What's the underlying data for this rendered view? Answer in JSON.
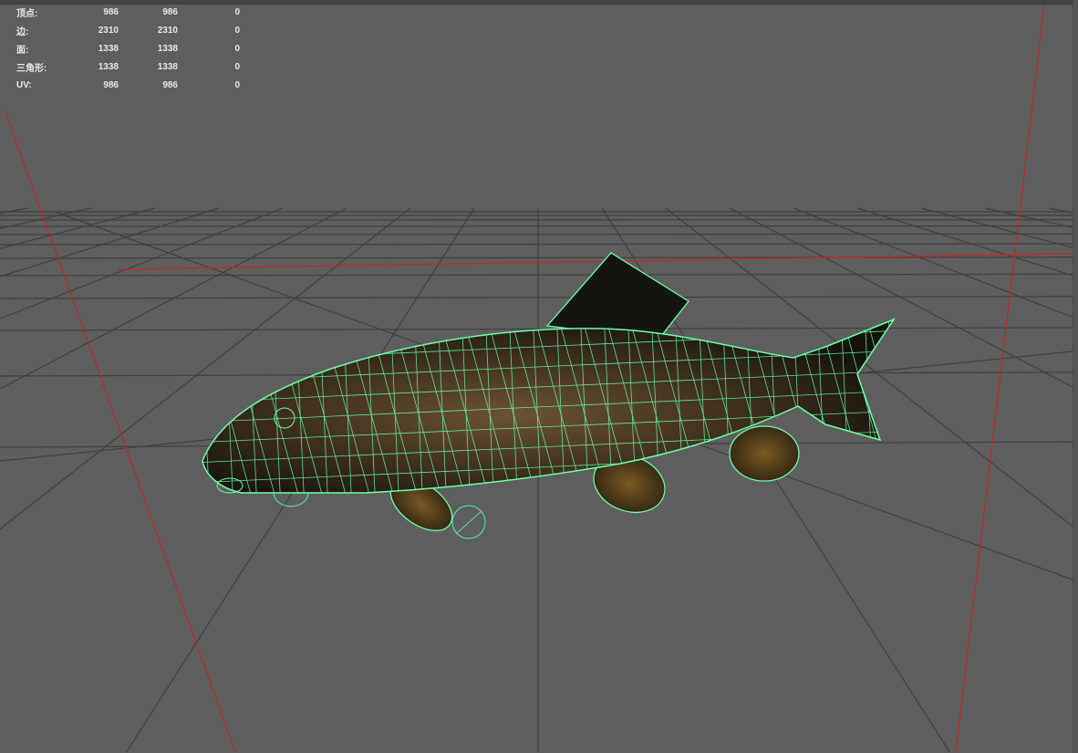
{
  "stats": {
    "rows": [
      {
        "label": "顶点:",
        "values": [
          "986",
          "986",
          "0"
        ]
      },
      {
        "label": "边:",
        "values": [
          "2310",
          "2310",
          "0"
        ]
      },
      {
        "label": "面:",
        "values": [
          "1338",
          "1338",
          "0"
        ]
      },
      {
        "label": "三角形:",
        "values": [
          "1338",
          "1338",
          "0"
        ]
      },
      {
        "label": "UV:",
        "values": [
          "986",
          "986",
          "0"
        ]
      }
    ]
  },
  "colors": {
    "background": "#5e5e5e",
    "wire": "#6dffa8",
    "axis": "#c0282a",
    "grid": "#3c3c3c"
  }
}
